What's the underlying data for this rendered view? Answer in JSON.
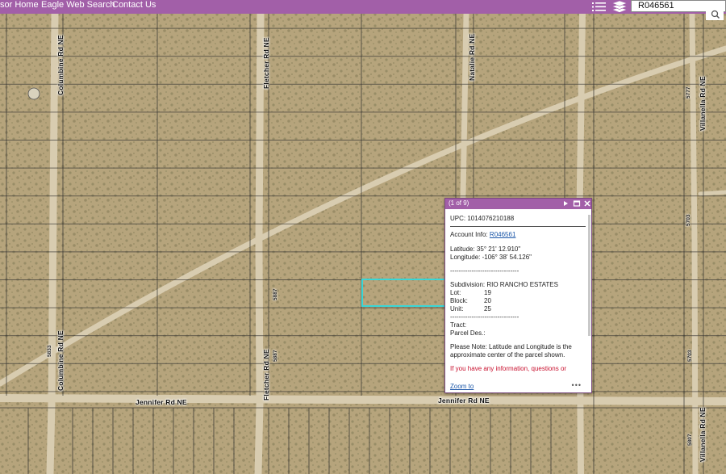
{
  "nav": {
    "links": [
      "sor Home",
      "Eagle Web Search",
      "Contact Us"
    ]
  },
  "icons": {
    "list": "list-icon",
    "layers": "layers-icon",
    "search": "search-icon"
  },
  "search": {
    "value": "R046561"
  },
  "roads": {
    "columbine": "Columbine Rd NE",
    "fletcher": "Fletcher Rd NE",
    "natalie": "Natalie Rd NE",
    "villanella": "Villanella Rd NE",
    "jennifer_w": "Jennifer Rd NE",
    "jennifer_e": "Jennifer Rd NE"
  },
  "addresses": [
    "5777",
    "5703",
    "5703",
    "5887",
    "5887",
    "5833",
    "5807"
  ],
  "popup": {
    "count": "(1 of 9)",
    "upc": "UPC: 1014076210188",
    "account_label": "Account Info: ",
    "account_link": "R046561",
    "latitude": "Latitude: 35° 21' 12.910\"",
    "longitude": "Longitude: -106° 38' 54.126\"",
    "dashes": "--------------------------------",
    "subdivision": "Subdivision: RIO RANCHO ESTATES",
    "lot_label": "Lot:",
    "lot_value": "19",
    "block_label": "Block:",
    "block_value": "20",
    "unit_label": "Unit:",
    "unit_value": "25",
    "tract": "Tract:",
    "parcel_des": "Parcel Des.:",
    "note": "Please Note: Latitude and Longitude is the approximate center of the parcel shown.",
    "info_text": "If you have any information, questions or",
    "zoom_link": "Zoom to",
    "more": "•••"
  },
  "colors": {
    "header": "#a25fa8",
    "highlight": "#3ad6d6",
    "link": "#1a56a8",
    "alert": "#c8102e"
  }
}
